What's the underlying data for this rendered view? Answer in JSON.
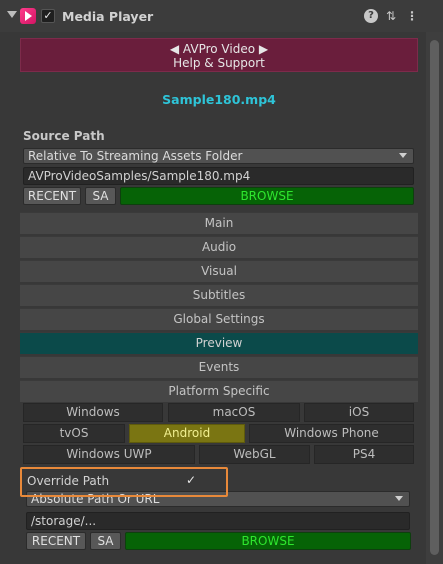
{
  "header": {
    "title": "Media Player",
    "icons": [
      "fold-arrow-icon",
      "media-player-icon",
      "checkbox-icon",
      "help-icon",
      "preset-icon",
      "context-menu-icon"
    ]
  },
  "banner": {
    "line1": "◀ AVPro Video ▶",
    "line2": "Help & Support"
  },
  "filename": "Sample180.mp4",
  "source": {
    "label": "Source Path",
    "location": "Relative To Streaming Assets Folder",
    "path": "AVProVideoSamples/Sample180.mp4",
    "recent_label": "RECENT",
    "sa_label": "SA",
    "browse_label": "BROWSE"
  },
  "tabs": [
    {
      "label": "Main",
      "active": false
    },
    {
      "label": "Audio",
      "active": false
    },
    {
      "label": "Visual",
      "active": false
    },
    {
      "label": "Subtitles",
      "active": false
    },
    {
      "label": "Global Settings",
      "active": false
    },
    {
      "label": "Preview",
      "active": true
    },
    {
      "label": "Events",
      "active": false
    },
    {
      "label": "Platform Specific",
      "active": false
    }
  ],
  "platforms": [
    {
      "label": "Windows",
      "active": false
    },
    {
      "label": "macOS",
      "active": false
    },
    {
      "label": "iOS",
      "active": false
    },
    {
      "label": "tvOS",
      "active": false
    },
    {
      "label": "Android",
      "active": true
    },
    {
      "label": "Windows Phone",
      "active": false
    },
    {
      "label": "Windows UWP",
      "active": false
    },
    {
      "label": "WebGL",
      "active": false
    },
    {
      "label": "PS4",
      "active": false
    }
  ],
  "override": {
    "label": "Override Path",
    "checked": true,
    "check_glyph": "✓",
    "location": "Absolute Path Or URL",
    "path": "/storage/...",
    "recent_label": "RECENT",
    "sa_label": "SA",
    "browse_label": "BROWSE"
  },
  "colors": {
    "banner": "#6a1e3c",
    "filename": "#2ec4d8",
    "browse_bg": "#066306",
    "browse_text": "#2ee62e",
    "preview_tab": "#0b4a4a",
    "android_active": "#7a7512",
    "highlight_border": "#e8893a"
  }
}
